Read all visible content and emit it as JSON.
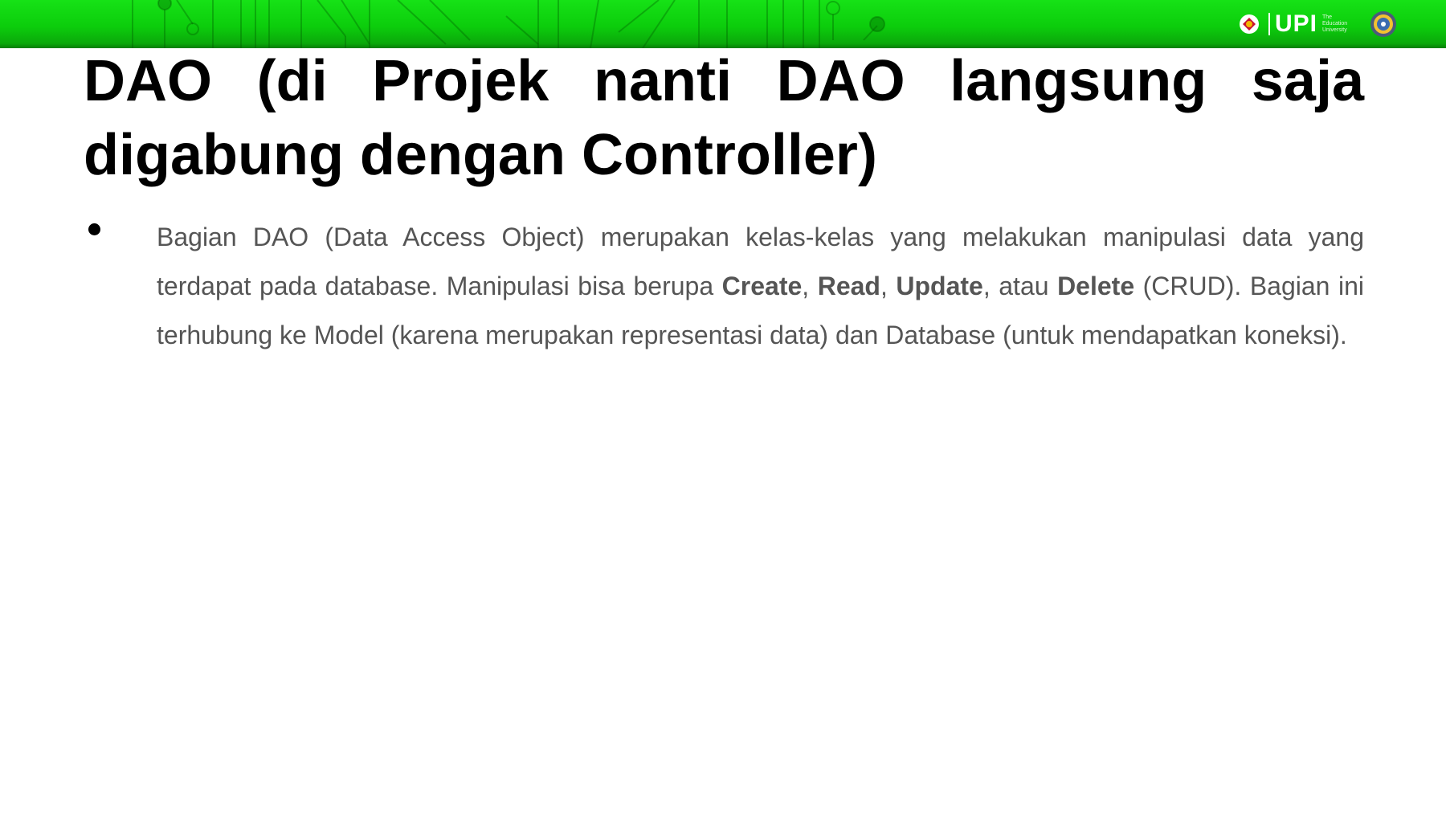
{
  "header": {
    "logo_text": "UPI",
    "logo_tagline": "The Education University"
  },
  "slide": {
    "title": "DAO (di Projek nanti DAO langsung saja digabung dengan Controller)",
    "bullet": {
      "part1": "Bagian DAO (Data Access Object) merupakan kelas-kelas yang melakukan manipulasi data yang terdapat pada database. Manipulasi bisa berupa ",
      "create": "Create",
      "sep1": ", ",
      "read": "Read",
      "sep2": ", ",
      "update": "Update",
      "sep3": ", atau ",
      "delete": "Delete",
      "part2": " (CRUD). Bagian ini terhubung ke Model (karena merupakan representasi data) dan Database (untuk mendapatkan koneksi)."
    }
  },
  "colors": {
    "header_green": "#0ccd0c",
    "title_color": "#000000",
    "body_color": "#555555"
  }
}
